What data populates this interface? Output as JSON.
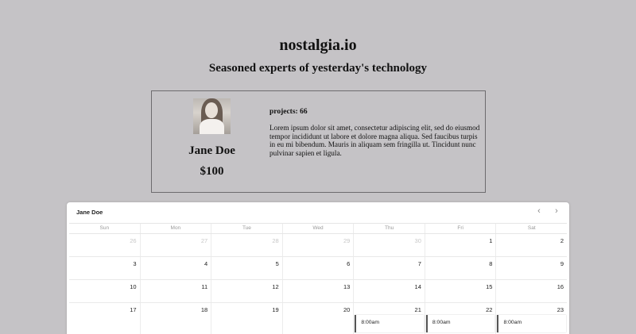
{
  "site": {
    "title": "nostalgia.io",
    "tagline": "Seasoned experts of yesterday's technology"
  },
  "profile": {
    "name": "Jane Doe",
    "price": "$100",
    "projects": "projects: 66",
    "bio": "Lorem ipsum dolor sit amet, consectetur adipiscing elit, sed do eiusmod tempor incididunt ut labore et dolore magna aliqua. Sed faucibus turpis in eu mi bibendum. Mauris in aliquam sem fringilla ut. Tincidunt nunc pulvinar sapien et ligula."
  },
  "calendar": {
    "title": "Jane Doe",
    "prev_icon": "chevron-left-icon",
    "next_icon": "chevron-right-icon",
    "days_of_week": [
      "Sun",
      "Mon",
      "Tue",
      "Wed",
      "Thu",
      "Fri",
      "Sat"
    ],
    "weeks": [
      [
        {
          "n": "26",
          "other": true
        },
        {
          "n": "27",
          "other": true
        },
        {
          "n": "28",
          "other": true
        },
        {
          "n": "29",
          "other": true
        },
        {
          "n": "30",
          "other": true
        },
        {
          "n": "1"
        },
        {
          "n": "2"
        }
      ],
      [
        {
          "n": "3"
        },
        {
          "n": "4"
        },
        {
          "n": "5"
        },
        {
          "n": "6"
        },
        {
          "n": "7"
        },
        {
          "n": "8"
        },
        {
          "n": "9"
        }
      ],
      [
        {
          "n": "10"
        },
        {
          "n": "11"
        },
        {
          "n": "12"
        },
        {
          "n": "13"
        },
        {
          "n": "14"
        },
        {
          "n": "15"
        },
        {
          "n": "16"
        }
      ],
      [
        {
          "n": "17"
        },
        {
          "n": "18"
        },
        {
          "n": "19"
        },
        {
          "n": "20"
        },
        {
          "n": "21",
          "event": "8:00am"
        },
        {
          "n": "22",
          "event": "8:00am"
        },
        {
          "n": "23",
          "event": "8:00am"
        }
      ]
    ]
  },
  "colors": {
    "page_background": "#c5c3c6",
    "card_border": "#6d6b6e",
    "calendar_background": "#ffffff"
  }
}
